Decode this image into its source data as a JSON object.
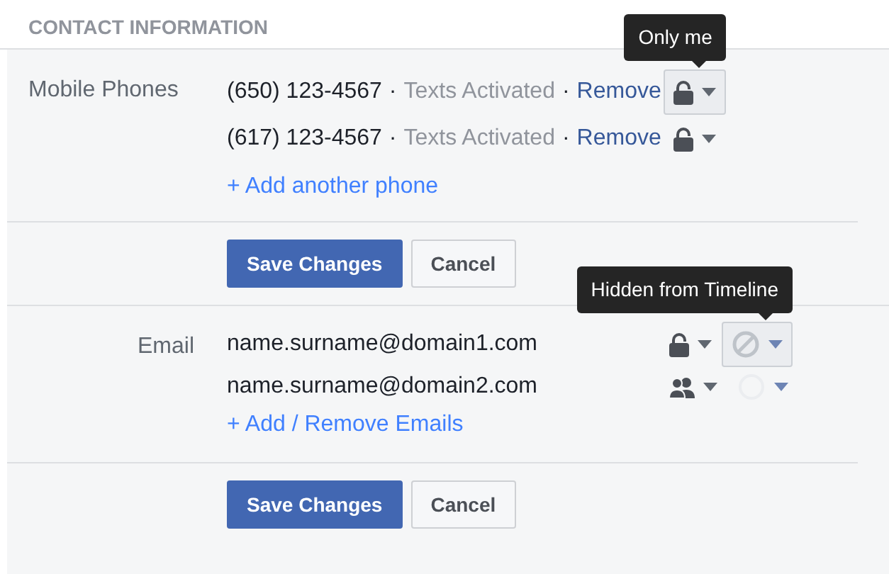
{
  "section_title": "CONTACT INFORMATION",
  "phones": {
    "label": "Mobile Phones",
    "separator": "·",
    "items": [
      {
        "number": "(650) 123-4567",
        "status": "Texts Activated",
        "action": "Remove",
        "audience": {
          "kind": "lock"
        },
        "active": true,
        "tooltip": "Only me"
      },
      {
        "number": "(617) 123-4567",
        "status": "Texts Activated",
        "action": "Remove",
        "audience": {
          "kind": "lock"
        },
        "active": false
      }
    ],
    "add_link": "+ Add another phone"
  },
  "phone_buttons": [
    {
      "label": "Save Changes",
      "kind": "primary"
    },
    {
      "label": "Cancel",
      "kind": "secondary"
    }
  ],
  "emails": {
    "label": "Email",
    "items": [
      {
        "address": "name.surname@domain1.com",
        "audience": {
          "kind": "lock"
        },
        "timeline": {
          "kind": "hidden"
        },
        "active": true,
        "tooltip": "Hidden from Timeline"
      },
      {
        "address": "name.surname@domain2.com",
        "audience": {
          "kind": "friends"
        },
        "timeline": {
          "kind": "shown"
        },
        "active": false
      }
    ],
    "add_link": "+ Add / Remove Emails"
  },
  "email_buttons": [
    {
      "label": "Save Changes",
      "kind": "primary"
    },
    {
      "label": "Cancel",
      "kind": "secondary"
    }
  ]
}
